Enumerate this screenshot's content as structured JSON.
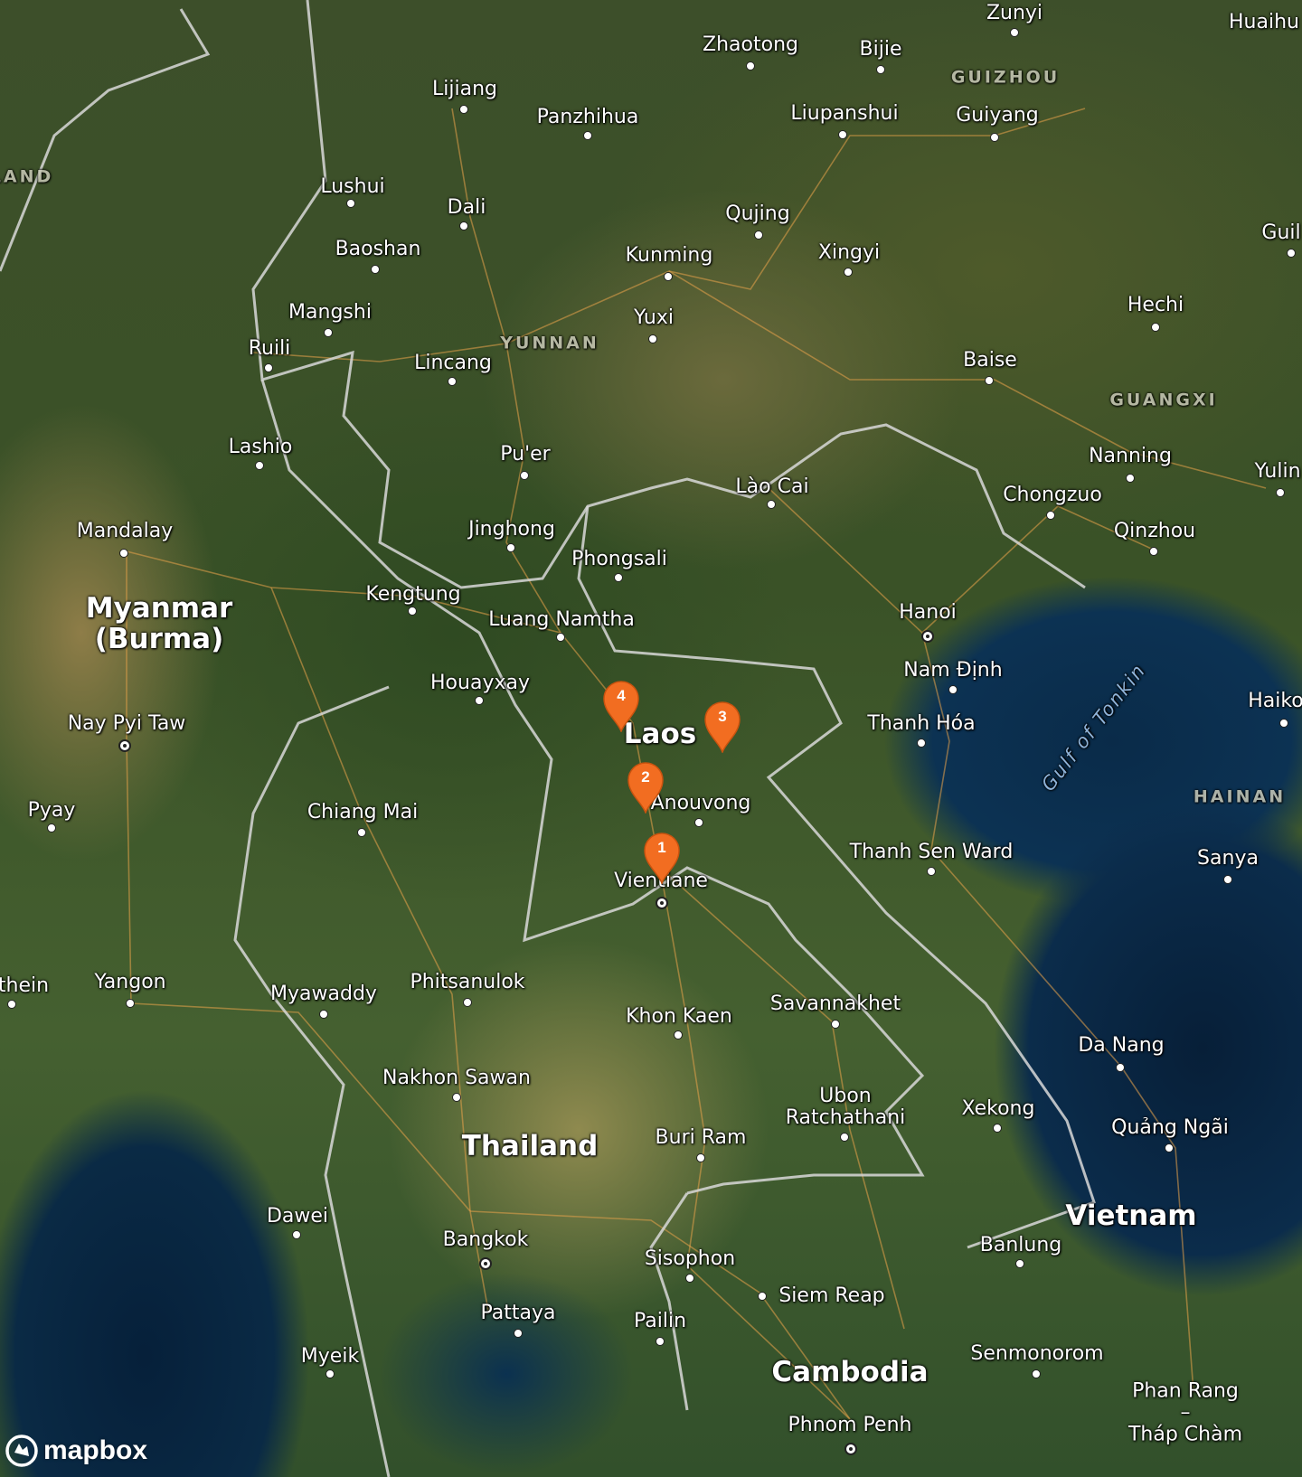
{
  "map": {
    "base_style": "satellite-streets",
    "countries": [
      {
        "id": "myanmar",
        "name": "Myanmar\n(Burma)"
      },
      {
        "id": "laos",
        "name": "Laos"
      },
      {
        "id": "thailand",
        "name": "Thailand"
      },
      {
        "id": "vietnam",
        "name": "Vietnam"
      },
      {
        "id": "cambodia",
        "name": "Cambodia"
      }
    ],
    "regions": [
      {
        "id": "yunnan",
        "name": "YUNNAN"
      },
      {
        "id": "guizhou",
        "name": "GUIZHOU"
      },
      {
        "id": "guangxi",
        "name": "GUANGXI"
      },
      {
        "id": "hainan",
        "name": "HAINAN"
      },
      {
        "id": "land-partial",
        "name": "LAND"
      }
    ],
    "water": [
      {
        "id": "gulf-of-tonkin",
        "name": "Gulf of Tonkin"
      }
    ],
    "cities": [
      {
        "id": "zunyi",
        "name": "Zunyi"
      },
      {
        "id": "huaihua",
        "name": "Huaihu"
      },
      {
        "id": "zhaotong",
        "name": "Zhaotong"
      },
      {
        "id": "bijie",
        "name": "Bijie"
      },
      {
        "id": "lijiang",
        "name": "Lijiang"
      },
      {
        "id": "panzhihua",
        "name": "Panzhihua"
      },
      {
        "id": "liupanshui",
        "name": "Liupanshui"
      },
      {
        "id": "guiyang",
        "name": "Guiyang"
      },
      {
        "id": "lushui",
        "name": "Lushui"
      },
      {
        "id": "dali",
        "name": "Dali"
      },
      {
        "id": "qujing",
        "name": "Qujing"
      },
      {
        "id": "guilin",
        "name": "Guil"
      },
      {
        "id": "baoshan",
        "name": "Baoshan"
      },
      {
        "id": "kunming",
        "name": "Kunming"
      },
      {
        "id": "xingyi",
        "name": "Xingyi"
      },
      {
        "id": "mangshi",
        "name": "Mangshi"
      },
      {
        "id": "yuxi",
        "name": "Yuxi"
      },
      {
        "id": "hechi",
        "name": "Hechi"
      },
      {
        "id": "ruili",
        "name": "Ruili"
      },
      {
        "id": "lincang",
        "name": "Lincang"
      },
      {
        "id": "baise",
        "name": "Baise"
      },
      {
        "id": "lashio",
        "name": "Lashio"
      },
      {
        "id": "puer",
        "name": "Pu'er"
      },
      {
        "id": "nanning",
        "name": "Nanning"
      },
      {
        "id": "yulin",
        "name": "Yulin"
      },
      {
        "id": "lao-cai",
        "name": "Lào Cai"
      },
      {
        "id": "chongzuo",
        "name": "Chongzuo"
      },
      {
        "id": "jinghong",
        "name": "Jinghong"
      },
      {
        "id": "qinzhou",
        "name": "Qinzhou"
      },
      {
        "id": "mandalay",
        "name": "Mandalay"
      },
      {
        "id": "phongsali",
        "name": "Phongsali"
      },
      {
        "id": "kengtung",
        "name": "Kengtung"
      },
      {
        "id": "luang-namtha",
        "name": "Luang Namtha"
      },
      {
        "id": "hanoi",
        "name": "Hanoi"
      },
      {
        "id": "nam-dinh",
        "name": "Nam Định"
      },
      {
        "id": "houayxay",
        "name": "Houayxay"
      },
      {
        "id": "haikou",
        "name": "Haiko"
      },
      {
        "id": "nay-pyi-taw",
        "name": "Nay Pyi Taw"
      },
      {
        "id": "thanh-hoa",
        "name": "Thanh Hóa"
      },
      {
        "id": "anouvong",
        "name": "Anouvong"
      },
      {
        "id": "chiang-mai",
        "name": "Chiang Mai"
      },
      {
        "id": "pyay",
        "name": "Pyay"
      },
      {
        "id": "thanh-sen-ward",
        "name": "Thanh Sen Ward"
      },
      {
        "id": "sanya",
        "name": "Sanya"
      },
      {
        "id": "vientiane",
        "name": "Vientiane"
      },
      {
        "id": "pathein",
        "name": "thein"
      },
      {
        "id": "yangon",
        "name": "Yangon"
      },
      {
        "id": "myawaddy",
        "name": "Myawaddy"
      },
      {
        "id": "phitsanulok",
        "name": "Phitsanulok"
      },
      {
        "id": "savannakhet",
        "name": "Savannakhet"
      },
      {
        "id": "khon-kaen",
        "name": "Khon Kaen"
      },
      {
        "id": "da-nang",
        "name": "Da Nang"
      },
      {
        "id": "nakhon-sawan",
        "name": "Nakhon Sawan"
      },
      {
        "id": "ubon-ratchathani",
        "name": "Ubon\nRatchathani"
      },
      {
        "id": "xekong",
        "name": "Xekong"
      },
      {
        "id": "quang-ngai",
        "name": "Quảng Ngãi"
      },
      {
        "id": "buri-ram",
        "name": "Buri Ram"
      },
      {
        "id": "dawei",
        "name": "Dawei"
      },
      {
        "id": "banlung",
        "name": "Banlung"
      },
      {
        "id": "bangkok",
        "name": "Bangkok"
      },
      {
        "id": "sisophon",
        "name": "Sisophon"
      },
      {
        "id": "siem-reap",
        "name": "Siem Reap"
      },
      {
        "id": "pattaya",
        "name": "Pattaya"
      },
      {
        "id": "pailin",
        "name": "Pailin"
      },
      {
        "id": "myeik",
        "name": "Myeik"
      },
      {
        "id": "senmonorom",
        "name": "Senmonorom"
      },
      {
        "id": "phan-rang",
        "name": "Phan Rang –\nTháp Chàm"
      },
      {
        "id": "phnom-penh",
        "name": "Phnom Penh"
      }
    ],
    "markers": [
      {
        "id": "marker-1",
        "label": "1",
        "color": "#f26d21"
      },
      {
        "id": "marker-2",
        "label": "2",
        "color": "#f26d21"
      },
      {
        "id": "marker-3",
        "label": "3",
        "color": "#f26d21"
      },
      {
        "id": "marker-4",
        "label": "4",
        "color": "#f26d21"
      }
    ]
  },
  "attribution": {
    "logo_text": "mapbox"
  }
}
